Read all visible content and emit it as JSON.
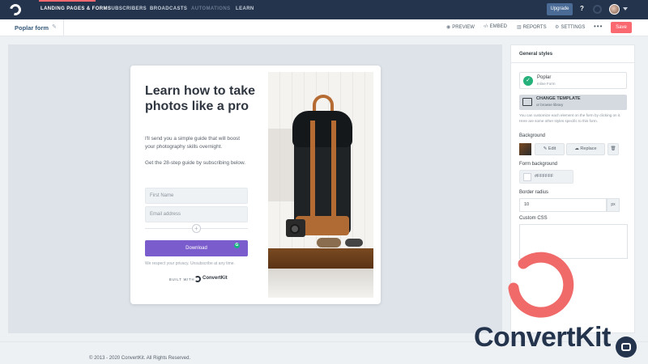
{
  "nav": {
    "items": [
      "LANDING PAGES & FORMS",
      "SUBSCRIBERS",
      "BROADCASTS",
      "AUTOMATIONS",
      "LEARN"
    ],
    "upgrade": "Upgrade",
    "help": "?"
  },
  "subheader": {
    "form_name": "Poplar form",
    "actions": [
      "PREVIEW",
      "EMBED",
      "REPORTS",
      "SETTINGS"
    ],
    "more": "•••",
    "save": "Save"
  },
  "form": {
    "headline": "Learn how to take photos like a pro",
    "paragraph1": "I'll send you a simple guide that will boost your photography skills overnight.",
    "paragraph2": "Get the 28-step guide by subscribing below.",
    "first_name_placeholder": "First Name",
    "email_placeholder": "Email address",
    "button": "Download",
    "privacy": "We respect your privacy. Unsubscribe at any time.",
    "built_with": "BUILT WITH",
    "brand": "ConvertKit"
  },
  "panel": {
    "title": "General styles",
    "template_name": "Poplar",
    "template_type": "Inline Form",
    "change_template": "CHANGE TEMPLATE",
    "change_sub": "or browse library",
    "help_text": "You can customize each element on the form by clicking on it. Here are some other styles specific to this form.",
    "background_label": "Background",
    "edit": "Edit",
    "replace": "Replace",
    "form_bg_label": "Form background",
    "form_bg_value": "#FFFFFF",
    "radius_label": "Border radius",
    "radius_value": "10",
    "radius_unit": "px",
    "css_label": "Custom CSS"
  },
  "footer": {
    "copyright": "© 2013 - 2020 ConvertKit. All Rights Reserved."
  },
  "watermark": {
    "brand": "ConvertKit"
  },
  "colors": {
    "nav_bg": "#24344d",
    "accent": "#fb6970",
    "button": "#7b5ccc",
    "check": "#26b07a"
  }
}
